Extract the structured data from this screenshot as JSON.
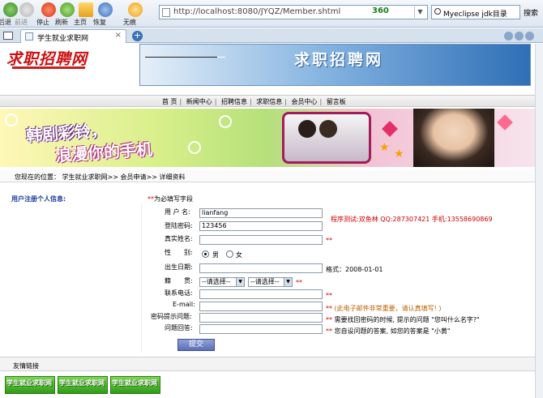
{
  "browser": {
    "toolbar": {
      "back": "后退",
      "forward": "前进",
      "stop": "停止",
      "refresh": "刷新",
      "home": "主页",
      "restore": "恢复",
      "traceless": "无痕"
    },
    "url": "http://localhost:8080/JYQZ/Member.shtml",
    "badge": "360",
    "search_value": "Myeclipse jdk目录",
    "search_button": "搜索",
    "tab_title": "学生就业求职网",
    "tab_close": "×",
    "new_tab": "+"
  },
  "site": {
    "logo_text": "求职招聘网",
    "banner_text": "求职招聘网",
    "nav": [
      "首 页",
      "新闻中心",
      "招聘信息",
      "求职信息",
      "会员中心",
      "留言板"
    ],
    "ad_line1": "韩剧彩铃，",
    "ad_line2": "浪漫你的手机",
    "location": "您现在的位置： 学生就业求职网>> 会员申请>> 详细资料"
  },
  "form": {
    "header": "用户注册个人信息:",
    "required_mark": "**",
    "required_note": "为必填写字段",
    "username_label": "用 户 名:",
    "username_value": "lianfang",
    "password_label": "登陆密码:",
    "password_value": "123456",
    "tester_note": "程序测试:双鱼林  QQ:287307421  手机:13558690869",
    "realname_label": "真实姓名:",
    "gender_label": "性　　别:",
    "gender_male": "男",
    "gender_female": "女",
    "birthday_label": "出生日期:",
    "birthday_hint": "格式：2008-01-01",
    "native_label": "籍　　贯:",
    "province_selected": "--请选择--",
    "city_selected": "--请选择--",
    "phone_label": "联系电话:",
    "email_label": "E-mail:",
    "email_hint": "(此电子邮件非常重要，请认真填写! )",
    "question_label": "密码提示问题:",
    "question_hint": "需要找回密码的时候, 提示的问题 \"您叫什么名字?\"",
    "answer_label": "问题回答:",
    "answer_hint": "您自设问题的答案, 如您的答案是 \"小黄\"",
    "submit": "提交"
  },
  "friend_links": {
    "header": "友情链接",
    "items": [
      "学生就业求职网",
      "学生就业求职网",
      "学生就业求职网"
    ]
  },
  "colors": {
    "required_red": "#d00000",
    "header_blue": "#1a3a9c",
    "banner_blue": "#2f6fb6",
    "link_green": "#2f9a18"
  }
}
